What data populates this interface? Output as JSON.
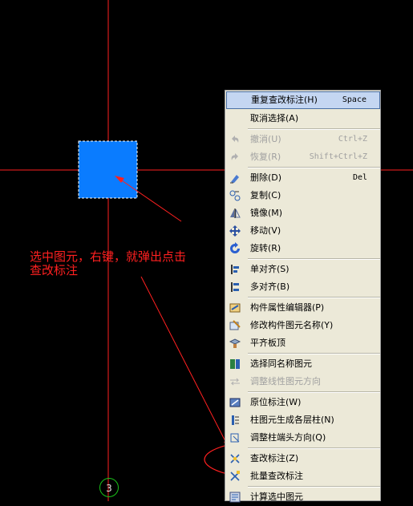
{
  "annotation": {
    "line1": "选中图元，右键，就弹出点击",
    "line2": "查改标注"
  },
  "axis_label": "3",
  "menu": {
    "items": [
      {
        "label": "重复查改标注(H)",
        "shortcut": "Space",
        "icon": "none",
        "highlighted": true
      },
      {
        "label": "取消选择(A)",
        "shortcut": "",
        "icon": "none"
      },
      {
        "sep": true
      },
      {
        "label": "撤消(U)",
        "shortcut": "Ctrl+Z",
        "icon": "undo-icon",
        "disabled": true
      },
      {
        "label": "恢复(R)",
        "shortcut": "Shift+Ctrl+Z",
        "icon": "redo-icon",
        "disabled": true
      },
      {
        "sep": true
      },
      {
        "label": "删除(D)",
        "shortcut": "Del",
        "icon": "eraser-icon"
      },
      {
        "label": "复制(C)",
        "shortcut": "",
        "icon": "copy-icon"
      },
      {
        "label": "镜像(M)",
        "shortcut": "",
        "icon": "mirror-icon"
      },
      {
        "label": "移动(V)",
        "shortcut": "",
        "icon": "move-icon"
      },
      {
        "label": "旋转(R)",
        "shortcut": "",
        "icon": "rotate-icon"
      },
      {
        "sep": true
      },
      {
        "label": "单对齐(S)",
        "shortcut": "",
        "icon": "align-single-icon"
      },
      {
        "label": "多对齐(B)",
        "shortcut": "",
        "icon": "align-multi-icon"
      },
      {
        "sep": true
      },
      {
        "label": "构件属性编辑器(P)",
        "shortcut": "",
        "icon": "property-editor-icon"
      },
      {
        "label": "修改构件图元名称(Y)",
        "shortcut": "",
        "icon": "rename-icon"
      },
      {
        "label": "平齐板顶",
        "shortcut": "",
        "icon": "slab-top-icon"
      },
      {
        "sep": true
      },
      {
        "label": "选择同名称图元",
        "shortcut": "",
        "icon": "select-same-icon"
      },
      {
        "label": "调整线性图元方向",
        "shortcut": "",
        "icon": "direction-icon",
        "disabled": true
      },
      {
        "sep": true
      },
      {
        "label": "原位标注(W)",
        "shortcut": "",
        "icon": "in-place-annotation-icon"
      },
      {
        "label": "柱图元生成各层柱(N)",
        "shortcut": "",
        "icon": "column-layers-icon"
      },
      {
        "label": "调整柱端头方向(Q)",
        "shortcut": "",
        "icon": "column-end-icon"
      },
      {
        "sep": true
      },
      {
        "label": "查改标注(Z)",
        "shortcut": "",
        "icon": "check-annotation-icon"
      },
      {
        "label": "批量查改标注",
        "shortcut": "",
        "icon": "batch-annotation-icon"
      },
      {
        "sep": true
      },
      {
        "label": "计算选中图元",
        "shortcut": "",
        "icon": "calculate-icon"
      }
    ]
  },
  "colors": {
    "background": "#000000",
    "axis": "#ff2020",
    "selected_element": "#0a7cff",
    "annotation": "#ff2020",
    "menu_bg": "#ece9d8",
    "highlight": "#c4d6f2"
  }
}
